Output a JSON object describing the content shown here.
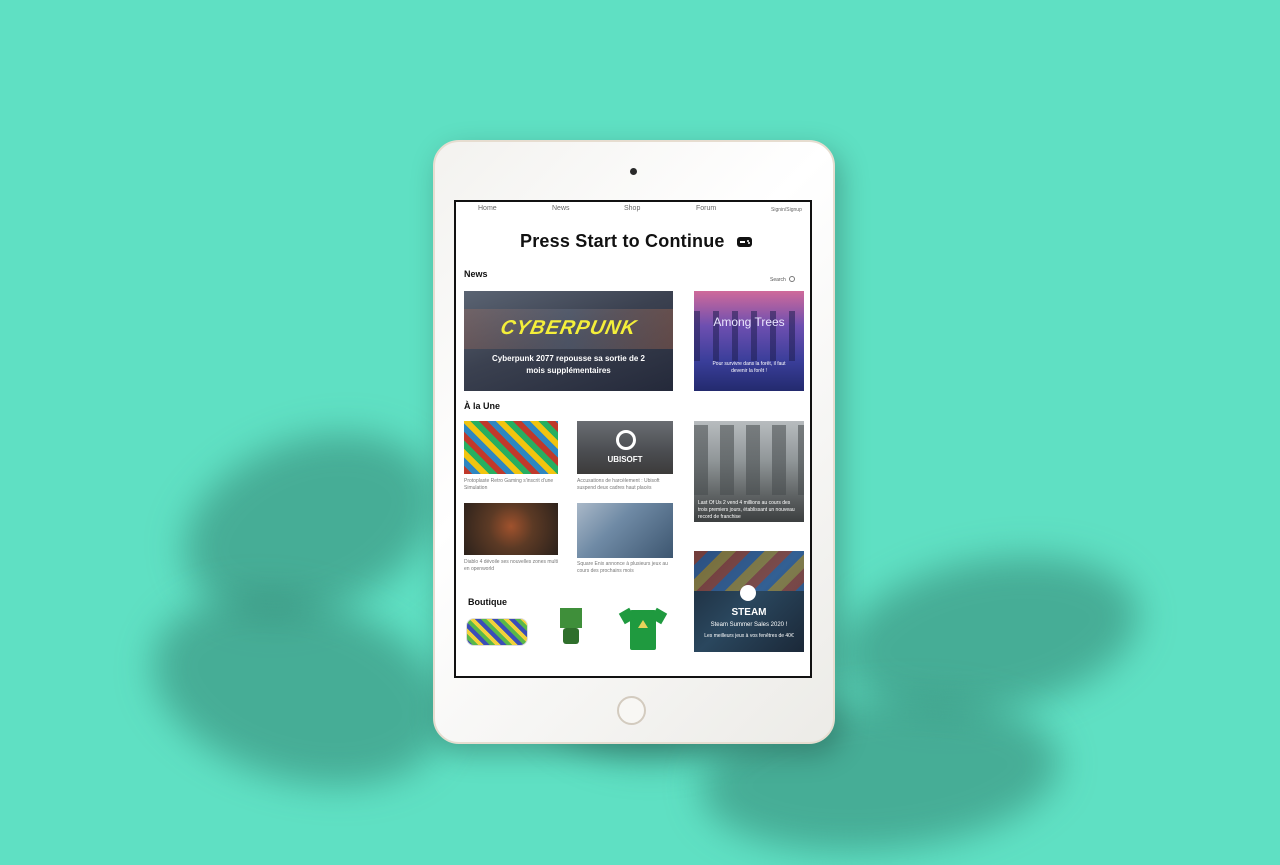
{
  "nav": {
    "items": [
      "Home",
      "News",
      "Shop",
      "Forum"
    ],
    "account": "Signin/Signup"
  },
  "site": {
    "title": "Press Start to Continue"
  },
  "news": {
    "heading": "News",
    "search_label": "Search",
    "main": {
      "logo": "CYBERPUNK",
      "headline": "Cyberpunk 2077 repousse sa sortie de 2 mois supplémentaires"
    },
    "side": {
      "title": "Among Trees",
      "caption": "Pour survivre dans la forêt, il faut devenir la forêt !"
    }
  },
  "a_la_une": {
    "heading": "À la Une",
    "articles": [
      {
        "caption": "Protoplaste Retro Gaming s'inscrit d'une Simulation"
      },
      {
        "logo": "UBISOFT",
        "caption": "Accusations de harcèlement : Ubisoft suspend deux cadres haut placés"
      },
      {
        "caption": "Diablo 4 dévoile ses nouvelles zones multi en openworld"
      },
      {
        "caption": "Square Enix annonce à plusieurs jeux au cours des prochains mois"
      }
    ],
    "side": {
      "caption": "Last Of Us 2 vend 4 millions au cours des trois premiers jours, établissant un nouveau record de franchise"
    }
  },
  "steam": {
    "logo": "STEAM",
    "title": "Steam Summer Sales 2020 !",
    "caption": "Les meilleurs jeux à vos fenêtres de 40€"
  },
  "shop": {
    "heading": "Boutique"
  }
}
